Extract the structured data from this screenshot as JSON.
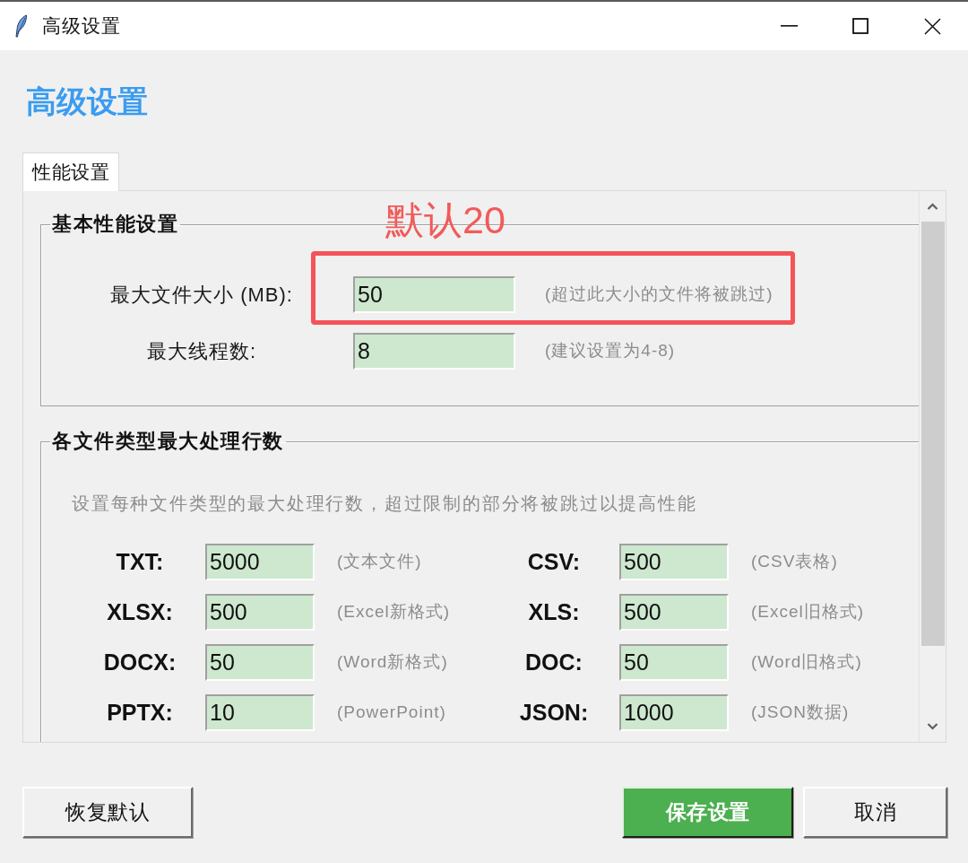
{
  "window": {
    "title": "高级设置"
  },
  "heading": "高级设置",
  "tabs": [
    {
      "label": "性能设置",
      "selected": true
    }
  ],
  "groups": [
    {
      "kind": "form",
      "title": "基本性能设置",
      "fields": [
        {
          "label": "最大文件大小 (MB):",
          "value": "50",
          "hint": "(超过此大小的文件将被跳过)",
          "highlighted": true,
          "callout": "默认20"
        },
        {
          "label": "最大线程数:",
          "value": "8",
          "hint": "(建议设置为4-8)",
          "highlighted": false
        }
      ]
    },
    {
      "kind": "grid",
      "title": "各文件类型最大处理行数",
      "description": "设置每种文件类型的最大处理行数，超过限制的部分将被跳过以提高性能",
      "fields": [
        {
          "label": "TXT:",
          "value": "5000",
          "hint": "(文本文件)"
        },
        {
          "label": "CSV:",
          "value": "500",
          "hint": "(CSV表格)"
        },
        {
          "label": "XLSX:",
          "value": "500",
          "hint": "(Excel新格式)"
        },
        {
          "label": "XLS:",
          "value": "500",
          "hint": "(Excel旧格式)"
        },
        {
          "label": "DOCX:",
          "value": "50",
          "hint": "(Word新格式)"
        },
        {
          "label": "DOC:",
          "value": "50",
          "hint": "(Word旧格式)"
        },
        {
          "label": "PPTX:",
          "value": "10",
          "hint": "(PowerPoint)"
        },
        {
          "label": "JSON:",
          "value": "1000",
          "hint": "(JSON数据)"
        }
      ]
    }
  ],
  "buttons": [
    {
      "label": "恢复默认",
      "kind": "secondary"
    },
    {
      "label": "保存设置",
      "kind": "primary"
    },
    {
      "label": "取消",
      "kind": "secondary"
    }
  ]
}
